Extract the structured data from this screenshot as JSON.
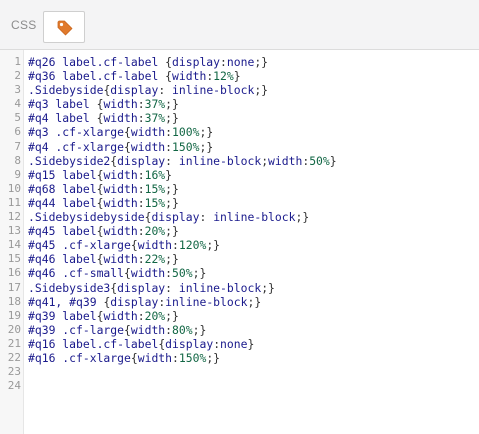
{
  "toolbar": {
    "mode_label": "CSS",
    "tag_button_icon": "tag-icon",
    "accent_color": "#e07a2c"
  },
  "lines": [
    {
      "n": "1",
      "tokens": [
        {
          "t": "#q26 label.cf-label ",
          "c": "sel"
        },
        {
          "t": "{",
          "c": "pun"
        },
        {
          "t": "display",
          "c": "prop"
        },
        {
          "t": ":",
          "c": "pun"
        },
        {
          "t": "none",
          "c": "val"
        },
        {
          "t": ";}",
          "c": "pun"
        }
      ]
    },
    {
      "n": "2",
      "tokens": [
        {
          "t": "#q36 label.cf-label ",
          "c": "sel"
        },
        {
          "t": "{",
          "c": "pun"
        },
        {
          "t": "width",
          "c": "prop"
        },
        {
          "t": ":",
          "c": "pun"
        },
        {
          "t": "12%",
          "c": "num"
        },
        {
          "t": "}",
          "c": "pun"
        }
      ]
    },
    {
      "n": "3",
      "tokens": [
        {
          "t": ".Sidebyside",
          "c": "sel"
        },
        {
          "t": "{",
          "c": "pun"
        },
        {
          "t": "display",
          "c": "prop"
        },
        {
          "t": ": ",
          "c": "pun"
        },
        {
          "t": "inline-block",
          "c": "val"
        },
        {
          "t": ";}",
          "c": "pun"
        }
      ]
    },
    {
      "n": "4",
      "tokens": [
        {
          "t": "#q3 label ",
          "c": "sel"
        },
        {
          "t": "{",
          "c": "pun"
        },
        {
          "t": "width",
          "c": "prop"
        },
        {
          "t": ":",
          "c": "pun"
        },
        {
          "t": "37%",
          "c": "num"
        },
        {
          "t": ";}",
          "c": "pun"
        }
      ]
    },
    {
      "n": "5",
      "tokens": [
        {
          "t": "#q4 label ",
          "c": "sel"
        },
        {
          "t": "{",
          "c": "pun"
        },
        {
          "t": "width",
          "c": "prop"
        },
        {
          "t": ":",
          "c": "pun"
        },
        {
          "t": "37%",
          "c": "num"
        },
        {
          "t": ";}",
          "c": "pun"
        }
      ]
    },
    {
      "n": "6",
      "tokens": [
        {
          "t": "#q3 .cf-xlarge",
          "c": "sel"
        },
        {
          "t": "{",
          "c": "pun"
        },
        {
          "t": "width",
          "c": "prop"
        },
        {
          "t": ":",
          "c": "pun"
        },
        {
          "t": "100%",
          "c": "num"
        },
        {
          "t": ";}",
          "c": "pun"
        }
      ]
    },
    {
      "n": "7",
      "tokens": [
        {
          "t": "#q4 .cf-xlarge",
          "c": "sel"
        },
        {
          "t": "{",
          "c": "pun"
        },
        {
          "t": "width",
          "c": "prop"
        },
        {
          "t": ":",
          "c": "pun"
        },
        {
          "t": "150%",
          "c": "num"
        },
        {
          "t": ";}",
          "c": "pun"
        }
      ]
    },
    {
      "n": "8",
      "tokens": [
        {
          "t": ".Sidebyside2",
          "c": "sel"
        },
        {
          "t": "{",
          "c": "pun"
        },
        {
          "t": "display",
          "c": "prop"
        },
        {
          "t": ": ",
          "c": "pun"
        },
        {
          "t": "inline-block",
          "c": "val"
        },
        {
          "t": ";",
          "c": "pun"
        },
        {
          "t": "width",
          "c": "prop"
        },
        {
          "t": ":",
          "c": "pun"
        },
        {
          "t": "50%",
          "c": "num"
        },
        {
          "t": "}",
          "c": "pun"
        }
      ]
    },
    {
      "n": "9",
      "tokens": [
        {
          "t": "#q15 label",
          "c": "sel"
        },
        {
          "t": "{",
          "c": "pun"
        },
        {
          "t": "width",
          "c": "prop"
        },
        {
          "t": ":",
          "c": "pun"
        },
        {
          "t": "16%",
          "c": "num"
        },
        {
          "t": "}",
          "c": "pun"
        }
      ]
    },
    {
      "n": "10",
      "tokens": [
        {
          "t": "#q68 label",
          "c": "sel"
        },
        {
          "t": "{",
          "c": "pun"
        },
        {
          "t": "width",
          "c": "prop"
        },
        {
          "t": ":",
          "c": "pun"
        },
        {
          "t": "15%",
          "c": "num"
        },
        {
          "t": ";}",
          "c": "pun"
        }
      ]
    },
    {
      "n": "11",
      "tokens": [
        {
          "t": "#q44 label",
          "c": "sel"
        },
        {
          "t": "{",
          "c": "pun"
        },
        {
          "t": "width",
          "c": "prop"
        },
        {
          "t": ":",
          "c": "pun"
        },
        {
          "t": "15%",
          "c": "num"
        },
        {
          "t": ";}",
          "c": "pun"
        }
      ]
    },
    {
      "n": "12",
      "tokens": [
        {
          "t": ".Sidebysidebyside",
          "c": "sel"
        },
        {
          "t": "{",
          "c": "pun"
        },
        {
          "t": "display",
          "c": "prop"
        },
        {
          "t": ": ",
          "c": "pun"
        },
        {
          "t": "inline-block",
          "c": "val"
        },
        {
          "t": ";}",
          "c": "pun"
        }
      ]
    },
    {
      "n": "13",
      "tokens": [
        {
          "t": "#q45 label",
          "c": "sel"
        },
        {
          "t": "{",
          "c": "pun"
        },
        {
          "t": "width",
          "c": "prop"
        },
        {
          "t": ":",
          "c": "pun"
        },
        {
          "t": "20%",
          "c": "num"
        },
        {
          "t": ";}",
          "c": "pun"
        }
      ]
    },
    {
      "n": "14",
      "tokens": [
        {
          "t": "#q45 .cf-xlarge",
          "c": "sel"
        },
        {
          "t": "{",
          "c": "pun"
        },
        {
          "t": "width",
          "c": "prop"
        },
        {
          "t": ":",
          "c": "pun"
        },
        {
          "t": "120%",
          "c": "num"
        },
        {
          "t": ";}",
          "c": "pun"
        }
      ]
    },
    {
      "n": "15",
      "tokens": [
        {
          "t": "#q46 label",
          "c": "sel"
        },
        {
          "t": "{",
          "c": "pun"
        },
        {
          "t": "width",
          "c": "prop"
        },
        {
          "t": ":",
          "c": "pun"
        },
        {
          "t": "22%",
          "c": "num"
        },
        {
          "t": ";}",
          "c": "pun"
        }
      ]
    },
    {
      "n": "16",
      "tokens": [
        {
          "t": "#q46 .cf-small",
          "c": "sel"
        },
        {
          "t": "{",
          "c": "pun"
        },
        {
          "t": "width",
          "c": "prop"
        },
        {
          "t": ":",
          "c": "pun"
        },
        {
          "t": "50%",
          "c": "num"
        },
        {
          "t": ";}",
          "c": "pun"
        }
      ]
    },
    {
      "n": "17",
      "tokens": [
        {
          "t": ".Sidebyside3",
          "c": "sel"
        },
        {
          "t": "{",
          "c": "pun"
        },
        {
          "t": "display",
          "c": "prop"
        },
        {
          "t": ": ",
          "c": "pun"
        },
        {
          "t": "inline-block",
          "c": "val"
        },
        {
          "t": ";}",
          "c": "pun"
        }
      ]
    },
    {
      "n": "18",
      "tokens": [
        {
          "t": "#q41, #q39 ",
          "c": "sel"
        },
        {
          "t": "{",
          "c": "pun"
        },
        {
          "t": "display",
          "c": "prop"
        },
        {
          "t": ":",
          "c": "pun"
        },
        {
          "t": "inline-block",
          "c": "val"
        },
        {
          "t": ";}",
          "c": "pun"
        }
      ]
    },
    {
      "n": "19",
      "tokens": [
        {
          "t": "#q39 label",
          "c": "sel"
        },
        {
          "t": "{",
          "c": "pun"
        },
        {
          "t": "width",
          "c": "prop"
        },
        {
          "t": ":",
          "c": "pun"
        },
        {
          "t": "20%",
          "c": "num"
        },
        {
          "t": ";}",
          "c": "pun"
        }
      ]
    },
    {
      "n": "20",
      "tokens": [
        {
          "t": "#q39 .cf-large",
          "c": "sel"
        },
        {
          "t": "{",
          "c": "pun"
        },
        {
          "t": "width",
          "c": "prop"
        },
        {
          "t": ":",
          "c": "pun"
        },
        {
          "t": "80%",
          "c": "num"
        },
        {
          "t": ";}",
          "c": "pun"
        }
      ]
    },
    {
      "n": "21",
      "tokens": [
        {
          "t": "#q16 label.cf-label",
          "c": "sel"
        },
        {
          "t": "{",
          "c": "pun"
        },
        {
          "t": "display",
          "c": "prop"
        },
        {
          "t": ":",
          "c": "pun"
        },
        {
          "t": "none",
          "c": "val"
        },
        {
          "t": "}",
          "c": "pun"
        }
      ]
    },
    {
      "n": "22",
      "tokens": [
        {
          "t": "#q16 .cf-xlarge",
          "c": "sel"
        },
        {
          "t": "{",
          "c": "pun"
        },
        {
          "t": "width",
          "c": "prop"
        },
        {
          "t": ":",
          "c": "pun"
        },
        {
          "t": "150%",
          "c": "num"
        },
        {
          "t": ";}",
          "c": "pun"
        }
      ]
    },
    {
      "n": "23",
      "tokens": []
    },
    {
      "n": "24",
      "tokens": []
    }
  ]
}
